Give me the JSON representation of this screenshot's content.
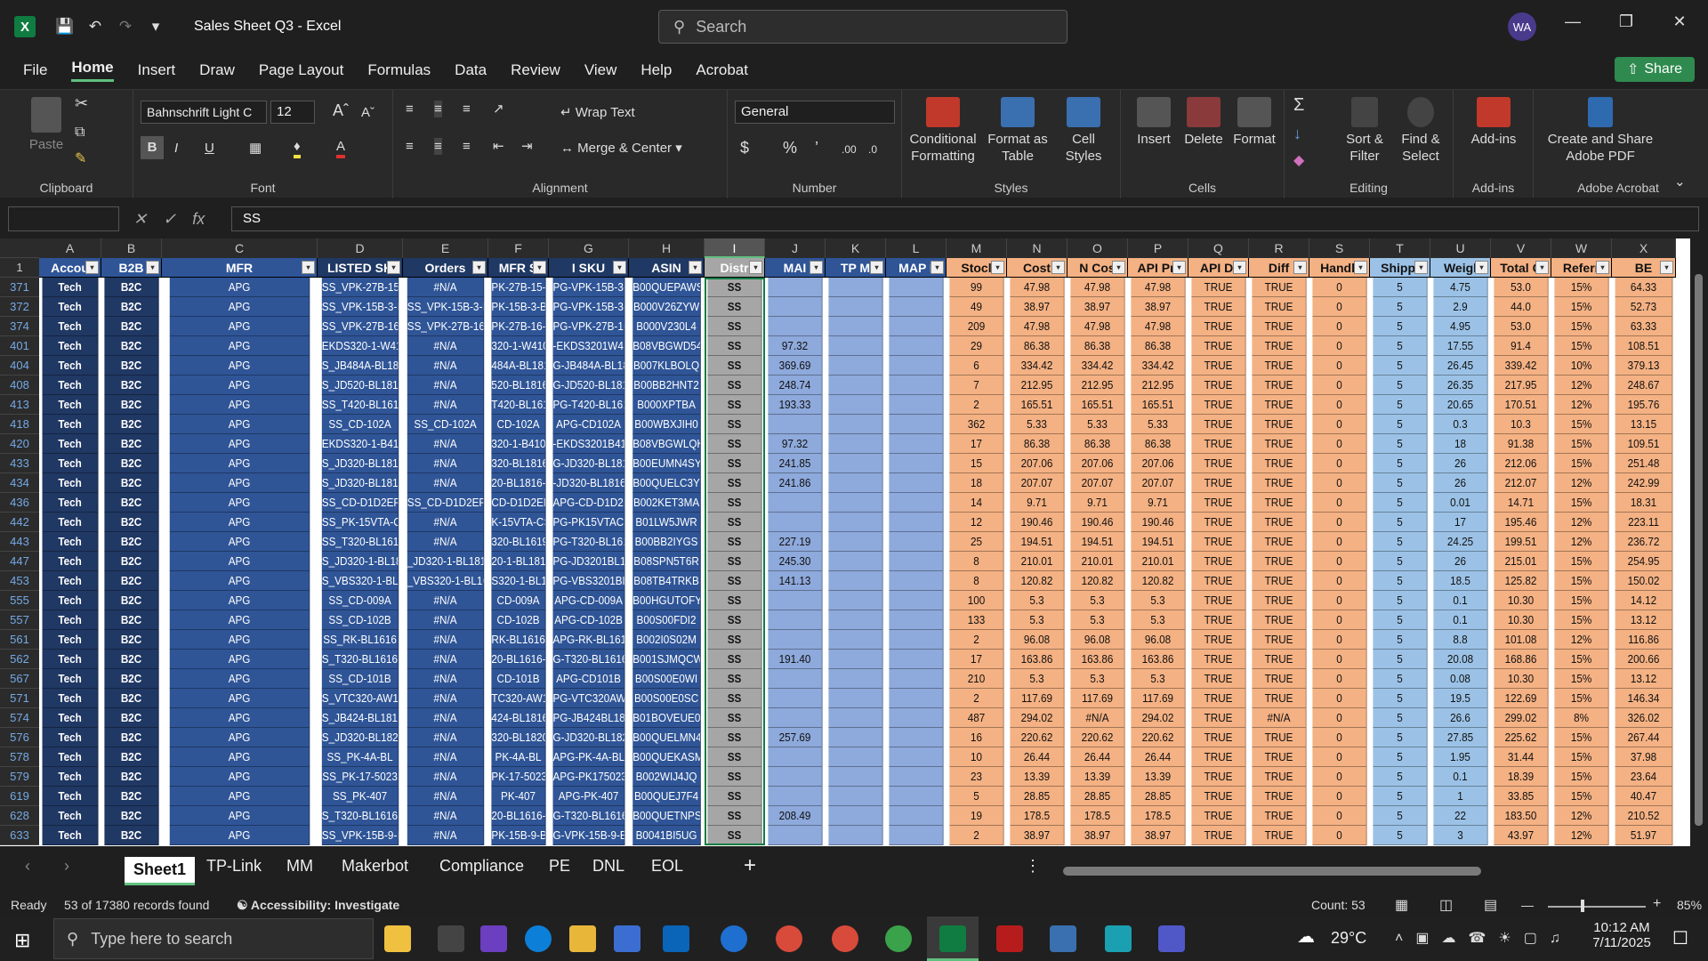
{
  "app": {
    "title": "Sales Sheet Q3  -  Excel",
    "icon": "excel-icon",
    "search_placeholder": "Search",
    "avatar": "WA",
    "share": "Share"
  },
  "menu": [
    "File",
    "Home",
    "Insert",
    "Draw",
    "Page Layout",
    "Formulas",
    "Data",
    "Review",
    "View",
    "Help",
    "Acrobat"
  ],
  "ribbon": {
    "paste": "Paste",
    "clipboard": "Clipboard",
    "font_name": "Bahnschrift Light C",
    "font_size": "12",
    "font": "Font",
    "wrap": "Wrap Text",
    "merge": "Merge & Center",
    "alignment": "Alignment",
    "numfmt": "General",
    "number": "Number",
    "cond": "Conditional Formatting",
    "fmt_table": "Format as Table",
    "cell_styles": "Cell Styles",
    "styles": "Styles",
    "insert": "Insert",
    "delete": "Delete",
    "format": "Format",
    "cells": "Cells",
    "sort": "Sort & Filter",
    "find": "Find & Select",
    "editing": "Editing",
    "addins": "Add-ins",
    "addins_group": "Add-ins",
    "acrobat": "Create and Share Adobe PDF",
    "acrobat_group": "Adobe Acrobat"
  },
  "formula": {
    "fx": "fx",
    "value": "SS"
  },
  "columns": [
    "A",
    "B",
    "C",
    "D",
    "E",
    "F",
    "G",
    "H",
    "I",
    "J",
    "K",
    "L",
    "M",
    "N",
    "O",
    "P",
    "Q",
    "R",
    "S",
    "T",
    "U",
    "V",
    "W",
    "X"
  ],
  "headers": [
    "Accou",
    "B2B",
    "MFR",
    "LISTED SK",
    "Orders",
    "MFR S",
    "I SKU",
    "ASIN",
    "Distr",
    "MAI",
    "TP M",
    "MAP I",
    "Stocl",
    "Cost",
    "N Cos",
    "API Pri",
    "API Di",
    "Diff",
    "Handli",
    "Shippi",
    "Weigl",
    "Total C",
    "Referr",
    "BE"
  ],
  "rows": [
    [
      "371",
      "Tech",
      "B2C",
      "APG",
      "SS_VPK-27B-15-B",
      "#N/A",
      "PK-27B-15-B",
      "PG-VPK-15B-3-E",
      "B00QUEPAWS",
      "SS",
      "",
      "",
      "",
      "99",
      "47.98",
      "47.98",
      "47.98",
      "TRUE",
      "TRUE",
      "0",
      "5",
      "4.75",
      "53.0",
      "15%",
      "64.33"
    ],
    [
      "372",
      "Tech",
      "B2C",
      "APG",
      "SS_VPK-15B-3-BX",
      "SS_VPK-15B-3-BX",
      "PK-15B-3-B",
      "PG-VPK-15B-3-E",
      "B000V26ZYW",
      "SS",
      "",
      "",
      "",
      "49",
      "38.97",
      "38.97",
      "38.97",
      "TRUE",
      "TRUE",
      "0",
      "5",
      "2.9",
      "44.0",
      "15%",
      "52.73"
    ],
    [
      "374",
      "Tech",
      "B2C",
      "APG",
      "SS_VPK-27B-16-B",
      "SS_VPK-27B-16-B",
      "PK-27B-16-B",
      "PG-VPK-27B-16-E",
      "B000V230L4",
      "SS",
      "",
      "",
      "",
      "209",
      "47.98",
      "47.98",
      "47.98",
      "TRUE",
      "TRUE",
      "0",
      "5",
      "4.95",
      "53.0",
      "15%",
      "63.33"
    ],
    [
      "401",
      "Tech",
      "B2C",
      "APG",
      "EKDS320-1-W410",
      "#N/A",
      "320-1-W410",
      "-EKDS3201W410",
      "B08VBGWD54",
      "SS",
      "97.32",
      "",
      "",
      "29",
      "86.38",
      "86.38",
      "86.38",
      "TRUE",
      "TRUE",
      "0",
      "5",
      "17.55",
      "91.4",
      "15%",
      "108.51"
    ],
    [
      "404",
      "Tech",
      "B2C",
      "APG",
      "S_JB484A-BL1816",
      "#N/A",
      "484A-BL1816",
      "G-JB484A-BL181",
      "B007KLBOLQ",
      "SS",
      "369.69",
      "",
      "",
      "6",
      "334.42",
      "334.42",
      "334.42",
      "TRUE",
      "TRUE",
      "0",
      "5",
      "26.45",
      "339.42",
      "10%",
      "379.13"
    ],
    [
      "408",
      "Tech",
      "B2C",
      "APG",
      "S_JD520-BL1816-",
      "#N/A",
      "520-BL1816",
      "G-JD520-BL1816",
      "B00BB2HNT2",
      "SS",
      "248.74",
      "",
      "",
      "7",
      "212.95",
      "212.95",
      "212.95",
      "TRUE",
      "TRUE",
      "0",
      "5",
      "26.35",
      "217.95",
      "12%",
      "248.67"
    ],
    [
      "413",
      "Tech",
      "B2C",
      "APG",
      "SS_T420-BL1616",
      "#N/A",
      "T420-BL1616",
      "PG-T420-BL161",
      "B000XPTBA",
      "SS",
      "193.33",
      "",
      "",
      "2",
      "165.51",
      "165.51",
      "165.51",
      "TRUE",
      "TRUE",
      "0",
      "5",
      "20.65",
      "170.51",
      "12%",
      "195.76"
    ],
    [
      "418",
      "Tech",
      "B2C",
      "APG",
      "SS_CD-102A",
      "SS_CD-102A",
      "CD-102A",
      "APG-CD102A",
      "B00WBXJIH0",
      "SS",
      "",
      "",
      "",
      "362",
      "5.33",
      "5.33",
      "5.33",
      "TRUE",
      "TRUE",
      "0",
      "5",
      "0.3",
      "10.3",
      "15%",
      "13.15"
    ],
    [
      "420",
      "Tech",
      "B2C",
      "APG",
      "EKDS320-1-B410-",
      "#N/A",
      "320-1-B410",
      "-EKDS3201B410",
      "B08VBGWLQK",
      "SS",
      "97.32",
      "",
      "",
      "17",
      "86.38",
      "86.38",
      "86.38",
      "TRUE",
      "TRUE",
      "0",
      "5",
      "18",
      "91.38",
      "15%",
      "109.51"
    ],
    [
      "433",
      "Tech",
      "B2C",
      "APG",
      "S_JD320-BL1816-",
      "#N/A",
      "320-BL1816",
      "G-JD320-BL1816",
      "B00EUMN4SY",
      "SS",
      "241.85",
      "",
      "",
      "15",
      "207.06",
      "207.06",
      "207.06",
      "TRUE",
      "TRUE",
      "0",
      "5",
      "26",
      "212.06",
      "15%",
      "251.48"
    ],
    [
      "434",
      "Tech",
      "B2C",
      "APG",
      "S_JD320-BL1816-C",
      "#N/A",
      "20-BL1816-C",
      "-JD320-BL1816-",
      "B00QUELC3Y",
      "SS",
      "241.86",
      "",
      "",
      "18",
      "207.07",
      "207.07",
      "207.07",
      "TRUE",
      "TRUE",
      "0",
      "5",
      "26",
      "212.07",
      "12%",
      "242.99"
    ],
    [
      "436",
      "Tech",
      "B2C",
      "APG",
      "SS_CD-D1D2EP",
      "SS_CD-D1D2EP",
      "CD-D1D2EP",
      "APG-CD-D1D2EP",
      "B002KET3MA",
      "SS",
      "",
      "",
      "",
      "14",
      "9.71",
      "9.71",
      "9.71",
      "TRUE",
      "TRUE",
      "0",
      "5",
      "0.01",
      "14.71",
      "15%",
      "18.31"
    ],
    [
      "442",
      "Tech",
      "B2C",
      "APG",
      "SS_PK-15VTA-CS6",
      "#N/A",
      "K-15VTA-CS",
      "PG-PK15VTACS6",
      "B01LW5JWR",
      "SS",
      "",
      "",
      "",
      "12",
      "190.46",
      "190.46",
      "190.46",
      "TRUE",
      "TRUE",
      "0",
      "5",
      "17",
      "195.46",
      "12%",
      "223.11"
    ],
    [
      "443",
      "Tech",
      "B2C",
      "APG",
      "SS_T320-BL16195",
      "#N/A",
      "320-BL1619",
      "PG-T320-BL1619",
      "B00BB2IYGS",
      "SS",
      "227.19",
      "",
      "",
      "25",
      "194.51",
      "194.51",
      "194.51",
      "TRUE",
      "TRUE",
      "0",
      "5",
      "24.25",
      "199.51",
      "12%",
      "236.72"
    ],
    [
      "447",
      "Tech",
      "B2C",
      "APG",
      "S_JD320-1-BL1816",
      "_JD320-1-BL1816",
      "20-1-BL181",
      "PG-JD3201BL181",
      "B08SPN5T6R",
      "SS",
      "245.30",
      "",
      "",
      "8",
      "210.01",
      "210.01",
      "210.01",
      "TRUE",
      "TRUE",
      "0",
      "5",
      "26",
      "215.01",
      "15%",
      "254.95"
    ],
    [
      "453",
      "Tech",
      "B2C",
      "APG",
      "S_VBS320-1-BL16",
      "_VBS320-1-BL16",
      "S320-1-BL16",
      "PG-VBS3201BL16",
      "B08TB4TRKB",
      "SS",
      "141.13",
      "",
      "",
      "8",
      "120.82",
      "120.82",
      "120.82",
      "TRUE",
      "TRUE",
      "0",
      "5",
      "18.5",
      "125.82",
      "15%",
      "150.02"
    ],
    [
      "555",
      "Tech",
      "B2C",
      "APG",
      "SS_CD-009A",
      "#N/A",
      "CD-009A",
      "APG-CD-009A",
      "B00HGUTOFY",
      "SS",
      "",
      "",
      "",
      "100",
      "5.3",
      "5.3",
      "5.3",
      "TRUE",
      "TRUE",
      "0",
      "5",
      "0.1",
      "10.30",
      "15%",
      "14.12"
    ],
    [
      "557",
      "Tech",
      "B2C",
      "APG",
      "SS_CD-102B",
      "#N/A",
      "CD-102B",
      "APG-CD-102B",
      "B00S00FDI2",
      "SS",
      "",
      "",
      "",
      "133",
      "5.3",
      "5.3",
      "5.3",
      "TRUE",
      "TRUE",
      "0",
      "5",
      "0.1",
      "10.30",
      "15%",
      "13.12"
    ],
    [
      "561",
      "Tech",
      "B2C",
      "APG",
      "SS_RK-BL1616",
      "#N/A",
      "RK-BL1616",
      "APG-RK-BL1616",
      "B002I0S02M",
      "SS",
      "",
      "",
      "",
      "2",
      "96.08",
      "96.08",
      "96.08",
      "TRUE",
      "TRUE",
      "0",
      "5",
      "8.8",
      "101.08",
      "12%",
      "116.86"
    ],
    [
      "562",
      "Tech",
      "B2C",
      "APG",
      "S_T320-BL1616-K",
      "#N/A",
      "20-BL1616-",
      "G-T320-BL1616",
      "B001SJMQCW",
      "SS",
      "191.40",
      "",
      "",
      "17",
      "163.86",
      "163.86",
      "163.86",
      "TRUE",
      "TRUE",
      "0",
      "5",
      "20.08",
      "168.86",
      "15%",
      "200.66"
    ],
    [
      "567",
      "Tech",
      "B2C",
      "APG",
      "SS_CD-101B",
      "#N/A",
      "CD-101B",
      "APG-CD101B",
      "B00S00E0WI",
      "SS",
      "",
      "",
      "",
      "210",
      "5.3",
      "5.3",
      "5.3",
      "TRUE",
      "TRUE",
      "0",
      "5",
      "0.08",
      "10.30",
      "15%",
      "13.12"
    ],
    [
      "571",
      "Tech",
      "B2C",
      "APG",
      "S_VTC320-AW161",
      "#N/A",
      "TC320-AW16",
      "PG-VTC320AW16",
      "B00S00E0SC",
      "SS",
      "",
      "",
      "",
      "2",
      "117.69",
      "117.69",
      "117.69",
      "TRUE",
      "TRUE",
      "0",
      "5",
      "19.5",
      "122.69",
      "15%",
      "146.34"
    ],
    [
      "574",
      "Tech",
      "B2C",
      "APG",
      "S_JB424-BL1816-",
      "#N/A",
      "424-BL1816",
      "PG-JB424BL1816",
      "B01BOVEUE0",
      "SS",
      "",
      "",
      "",
      "487",
      "294.02",
      "#N/A",
      "294.02",
      "TRUE",
      "#N/A",
      "0",
      "5",
      "26.6",
      "299.02",
      "8%",
      "326.02"
    ],
    [
      "576",
      "Tech",
      "B2C",
      "APG",
      "S_JD320-BL1820-",
      "#N/A",
      "320-BL1820",
      "G-JD320-BL182",
      "B00QUELMN4",
      "SS",
      "257.69",
      "",
      "",
      "16",
      "220.62",
      "220.62",
      "220.62",
      "TRUE",
      "TRUE",
      "0",
      "5",
      "27.85",
      "225.62",
      "15%",
      "267.44"
    ],
    [
      "578",
      "Tech",
      "B2C",
      "APG",
      "SS_PK-4A-BL",
      "#N/A",
      "PK-4A-BL",
      "APG-PK-4A-BL",
      "B00QUEKASM",
      "SS",
      "",
      "",
      "",
      "10",
      "26.44",
      "26.44",
      "26.44",
      "TRUE",
      "TRUE",
      "0",
      "5",
      "1.95",
      "31.44",
      "15%",
      "37.98"
    ],
    [
      "579",
      "Tech",
      "B2C",
      "APG",
      "SS_PK-17-5023",
      "#N/A",
      "PK-17-5023",
      "APG-PK175023",
      "B002WIJ4JQ",
      "SS",
      "",
      "",
      "",
      "23",
      "13.39",
      "13.39",
      "13.39",
      "TRUE",
      "TRUE",
      "0",
      "5",
      "0.1",
      "18.39",
      "15%",
      "23.64"
    ],
    [
      "619",
      "Tech",
      "B2C",
      "APG",
      "SS_PK-407",
      "#N/A",
      "PK-407",
      "APG-PK-407",
      "B00QUEJ7F4",
      "SS",
      "",
      "",
      "",
      "5",
      "28.85",
      "28.85",
      "28.85",
      "TRUE",
      "TRUE",
      "0",
      "5",
      "1",
      "33.85",
      "15%",
      "40.47"
    ],
    [
      "628",
      "Tech",
      "B2C",
      "APG",
      "S_T320-BL1616-U",
      "#N/A",
      "20-BL1616-",
      "G-T320-BL1616",
      "B00QUETNPS",
      "SS",
      "208.49",
      "",
      "",
      "19",
      "178.5",
      "178.5",
      "178.5",
      "TRUE",
      "TRUE",
      "0",
      "5",
      "22",
      "183.50",
      "12%",
      "210.52"
    ],
    [
      "633",
      "Tech",
      "B2C",
      "APG",
      "SS_VPK-15B-9-BX",
      "#N/A",
      "PK-15B-9-B",
      "G-VPK-15B-9-E",
      "B0041BI5UG",
      "SS",
      "",
      "",
      "",
      "2",
      "38.97",
      "38.97",
      "38.97",
      "TRUE",
      "TRUE",
      "0",
      "5",
      "3",
      "43.97",
      "12%",
      "51.97"
    ]
  ],
  "sheets": [
    "Sheet1",
    "TP-Link",
    "MM",
    "Makerbot",
    "Compliance",
    "PE",
    "DNL",
    "EOL"
  ],
  "status": {
    "ready": "Ready",
    "records": "53 of 17380 records found",
    "access": "Accessibility: Investigate",
    "count": "Count: 53",
    "zoom": "85%"
  },
  "taskbar": {
    "search": "Type here to search",
    "temp": "29°C",
    "time": "10:12 AM",
    "date": "7/11/2025"
  },
  "colors": {
    "accent": "#107c41",
    "dark_blue": "#1f3864",
    "blue": "#8ea9db",
    "navy": "#203864",
    "orange": "#f4b183",
    "light_blue": "#9bc2e6",
    "gray": "#a6a6a6"
  }
}
